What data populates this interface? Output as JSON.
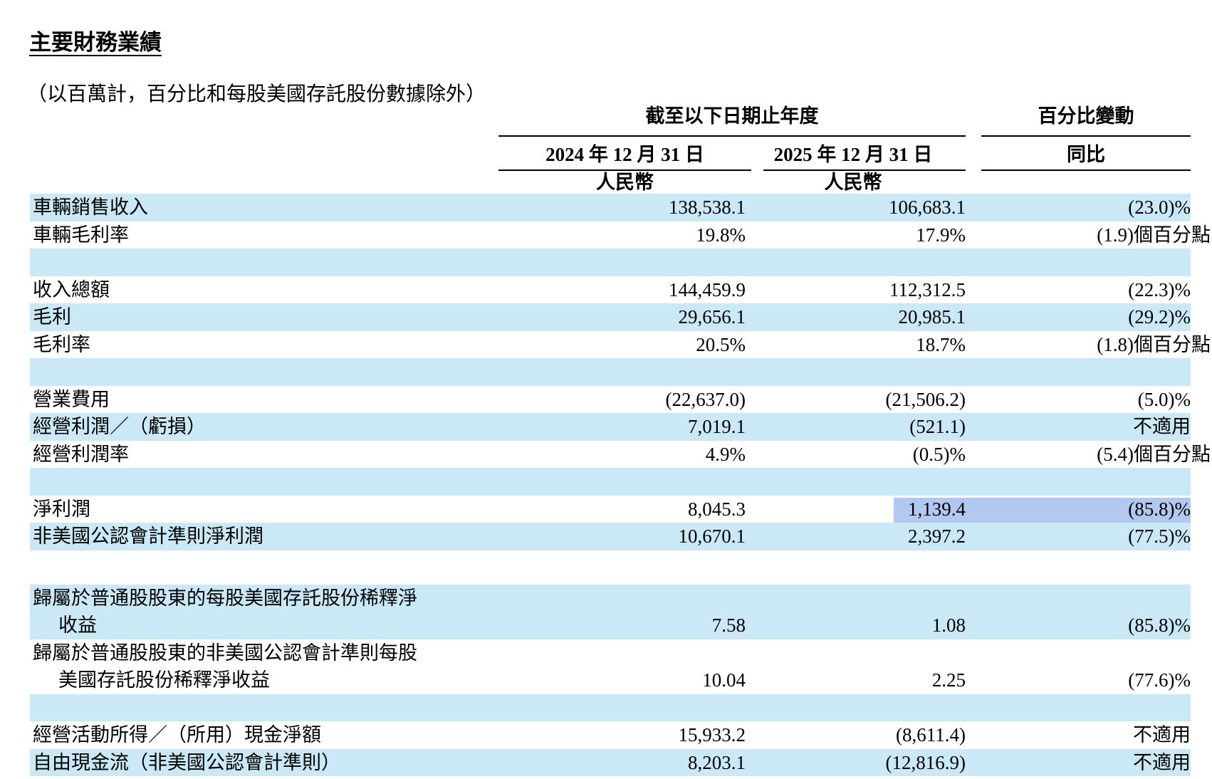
{
  "page": {
    "title": "主要財務業績",
    "units_note": "（以百萬計，百分比和每股美國存託股份數據除外）"
  },
  "colors": {
    "row_band": "#cbe8f7",
    "selection_highlight": "#b3c8ef"
  },
  "table": {
    "header": {
      "period_group": "截至以下日期止年度",
      "change_group": "百分比變動",
      "col_2024": "2024 年 12 月 31 日",
      "col_2025": "2025 年 12 月 31 日",
      "col_yoy": "同比",
      "currency_2024": "人民幣",
      "currency_2025": "人民幣"
    },
    "rows": [
      {
        "type": "data",
        "shaded": true,
        "label": "車輛銷售收入",
        "v2024": "138,538.1",
        "v2025": "106,683.1",
        "change": "(23.0)%"
      },
      {
        "type": "data",
        "shaded": false,
        "label": "車輛毛利率",
        "v2024": "19.8%",
        "v2025": "17.9%",
        "change": "(1.9)個百分點"
      },
      {
        "type": "spacer",
        "shaded": true
      },
      {
        "type": "data",
        "shaded": false,
        "label": "收入總額",
        "v2024": "144,459.9",
        "v2025": "112,312.5",
        "change": "(22.3)%"
      },
      {
        "type": "data",
        "shaded": true,
        "label": "毛利",
        "v2024": "29,656.1",
        "v2025": "20,985.1",
        "change": "(29.2)%"
      },
      {
        "type": "data",
        "shaded": false,
        "label": "毛利率",
        "v2024": "20.5%",
        "v2025": "18.7%",
        "change": "(1.8)個百分點"
      },
      {
        "type": "spacer",
        "shaded": true
      },
      {
        "type": "data",
        "shaded": false,
        "label": "營業費用",
        "v2024": "(22,637.0)",
        "v2025": "(21,506.2)",
        "change": "(5.0)%"
      },
      {
        "type": "data",
        "shaded": true,
        "label": "經營利潤／（虧損）",
        "v2024": "7,019.1",
        "v2025": "(521.1)",
        "change": "不適用"
      },
      {
        "type": "data",
        "shaded": false,
        "label": "經營利潤率",
        "v2024": "4.9%",
        "v2025": "(0.5)%",
        "change": "(5.4)個百分點"
      },
      {
        "type": "spacer",
        "shaded": true
      },
      {
        "type": "data",
        "shaded": false,
        "selected": true,
        "label": "淨利潤",
        "v2024": "8,045.3",
        "v2025": "1,139.4",
        "change": "(85.8)%"
      },
      {
        "type": "data",
        "shaded": true,
        "label": "非美國公認會計準則淨利潤",
        "v2024": "10,670.1",
        "v2025": "2,397.2",
        "change": "(77.5)%"
      },
      {
        "type": "gap",
        "shaded": false
      },
      {
        "type": "data2",
        "shaded": true,
        "label1": "歸屬於普通股股東的每股美國存託股份稀釋淨",
        "label2": "收益",
        "v2024": "7.58",
        "v2025": "1.08",
        "change": "(85.8)%"
      },
      {
        "type": "data2",
        "shaded": false,
        "label1": "歸屬於普通股股東的非美國公認會計準則每股",
        "label2": "美國存託股份稀釋淨收益",
        "v2024": "10.04",
        "v2025": "2.25",
        "change": "(77.6)%"
      },
      {
        "type": "spacer",
        "shaded": true
      },
      {
        "type": "data",
        "shaded": false,
        "label": "經營活動所得／（所用）現金淨額",
        "v2024": "15,933.2",
        "v2025": "(8,611.4)",
        "change": "不適用"
      },
      {
        "type": "data",
        "shaded": true,
        "label": "自由現金流（非美國公認會計準則）",
        "v2024": "8,203.1",
        "v2025": "(12,816.9)",
        "change": "不適用"
      }
    ]
  }
}
